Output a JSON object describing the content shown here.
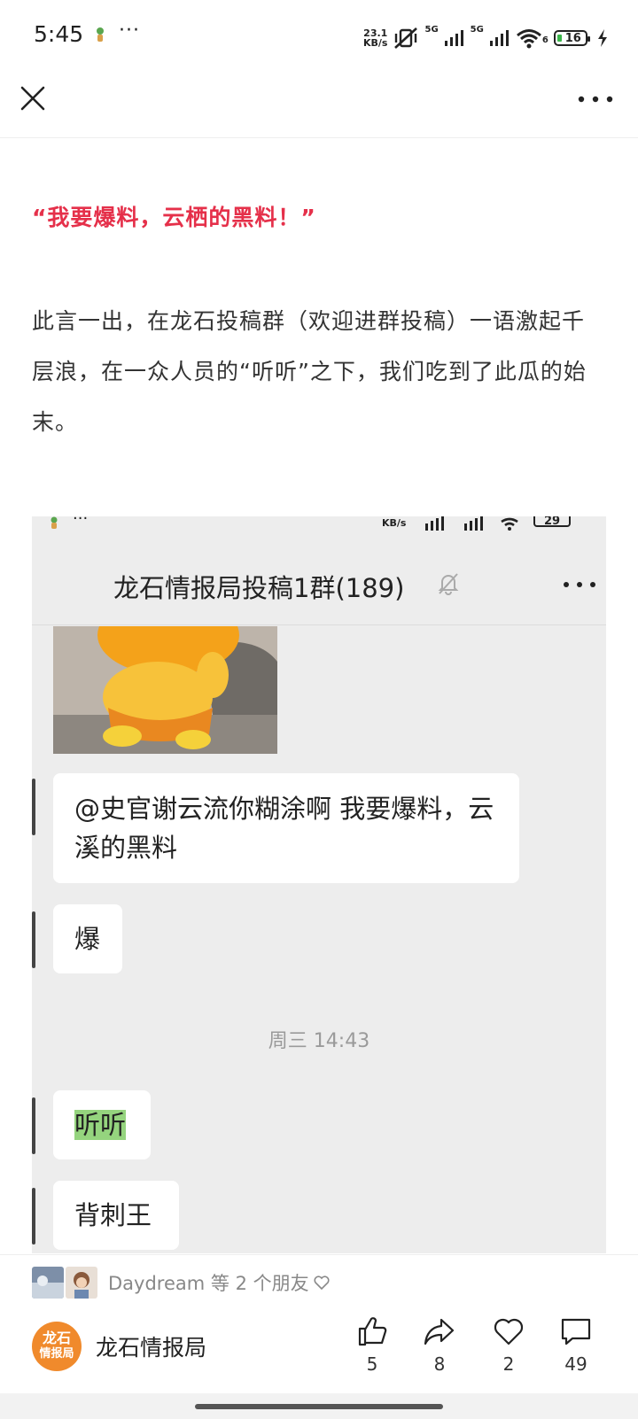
{
  "status_bar": {
    "time": "5:45",
    "more": "···",
    "net_speed_value": "23.1",
    "net_speed_unit": "KB/s",
    "signal1_label": "5G",
    "signal2_label": "5G",
    "wifi_label": "6",
    "battery": "16"
  },
  "nav": {
    "close_icon": "close-icon",
    "more_icon": "more-icon"
  },
  "article": {
    "quote": "“我要爆料，云栖的黑料！”",
    "paragraph": "此言一出，在龙石投稿群（欢迎进群投稿）一语激起千层浪，在一众人员的“听听”之下，我们吃到了此瓜的始末。"
  },
  "embedded_chat": {
    "status_battery": "29",
    "title": "龙石情报局投稿1群(189)",
    "messages": [
      {
        "text": "@史官谢云流你糊涂啊  我要爆料，云溪的黑料"
      },
      {
        "text": "爆"
      },
      {
        "text": "听听"
      },
      {
        "text": "背刺王"
      }
    ],
    "timestamp": "周三 14:43"
  },
  "footer": {
    "friends_text": "Daydream 等 2 个朋友",
    "account_logo_line1": "龙石",
    "account_logo_line2": "情报局",
    "account_name": "龙石情报局",
    "like_count": "5",
    "share_count": "8",
    "favorite_count": "2",
    "comment_count": "49"
  },
  "colors": {
    "quote_red": "#e5304a",
    "logo_orange": "#f08a2c",
    "highlight_green": "#95d47e"
  }
}
